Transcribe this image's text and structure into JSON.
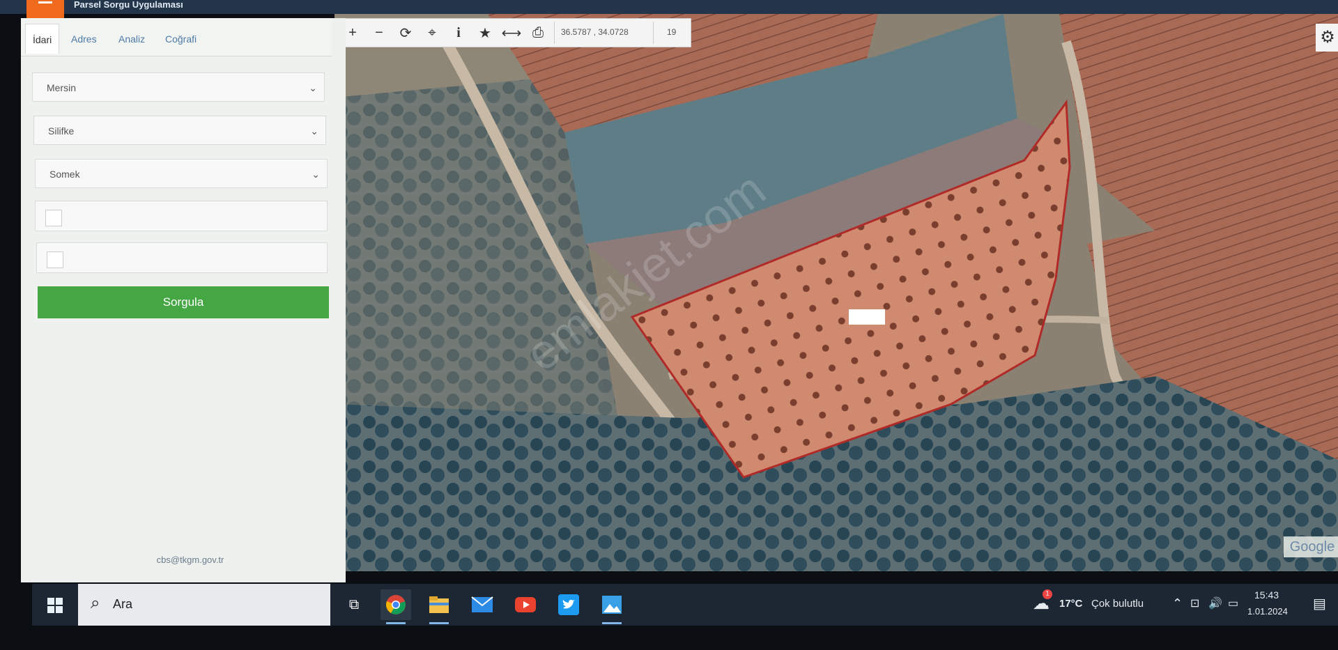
{
  "app": {
    "title": "Parsel Sorgu Uygulaması"
  },
  "tabs": [
    {
      "label": "İdari"
    },
    {
      "label": "Adres"
    },
    {
      "label": "Analiz"
    },
    {
      "label": "Coğrafi"
    }
  ],
  "selects": {
    "province": "Mersin",
    "district": "Silifke",
    "neighborhood": "Somek"
  },
  "inputs": {
    "block": "",
    "parcel": ""
  },
  "submit_label": "Sorgula",
  "footer_email": "cbs@tkgm.gov.tr",
  "toolbar": {
    "coords": "36.5787 , 34.0728",
    "zoom": "19",
    "icons": [
      "zoom-in-icon",
      "zoom-out-icon",
      "refresh-icon",
      "locate-icon",
      "info-icon",
      "bookmark-icon",
      "measure-icon",
      "print-icon"
    ]
  },
  "map": {
    "attribution": "Google",
    "watermark": "emlakjet.com",
    "parcel_outline_color": "#b02a28"
  },
  "taskbar": {
    "search_placeholder": "Ara",
    "weather_temp": "17°C",
    "weather_text": "Çok bulutlu",
    "notification_count": "1",
    "time": "15:43",
    "date": "1.01.2024"
  },
  "colors": {
    "accent_orange": "#f06a1d",
    "submit_green": "#45a744",
    "topbar": "#23354a"
  }
}
